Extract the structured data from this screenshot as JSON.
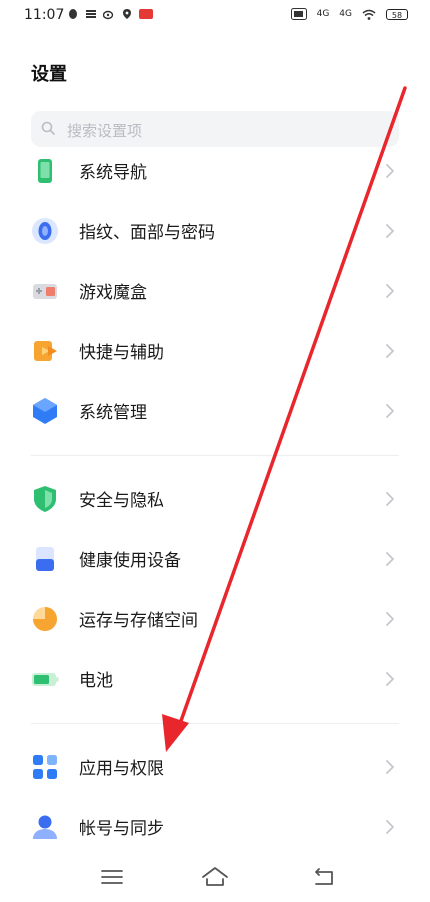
{
  "status_bar": {
    "time": "11:07",
    "network_1": "4G",
    "network_2": "4G",
    "battery": "58"
  },
  "header": {
    "title": "设置"
  },
  "search": {
    "placeholder": "搜索设置项"
  },
  "settings_items": [
    {
      "label": "系统导航",
      "icon": "phone-icon"
    },
    {
      "label": "指纹、面部与密码",
      "icon": "fingerprint-icon"
    },
    {
      "label": "游戏魔盒",
      "icon": "game-box-icon"
    },
    {
      "label": "快捷与辅助",
      "icon": "shortcut-icon"
    },
    {
      "label": "系统管理",
      "icon": "system-hexagon-icon"
    },
    {
      "label": "安全与隐私",
      "icon": "shield-icon"
    },
    {
      "label": "健康使用设备",
      "icon": "hourglass-icon"
    },
    {
      "label": "运存与存储空间",
      "icon": "pie-chart-icon"
    },
    {
      "label": "电池",
      "icon": "battery-icon"
    },
    {
      "label": "应用与权限",
      "icon": "apps-grid-icon"
    },
    {
      "label": "帐号与同步",
      "icon": "account-icon"
    }
  ],
  "colors": {
    "accent_blue": "#2f7cf6",
    "arrow_red": "#e8262b",
    "green": "#2fbf71",
    "orange": "#f7a531"
  }
}
